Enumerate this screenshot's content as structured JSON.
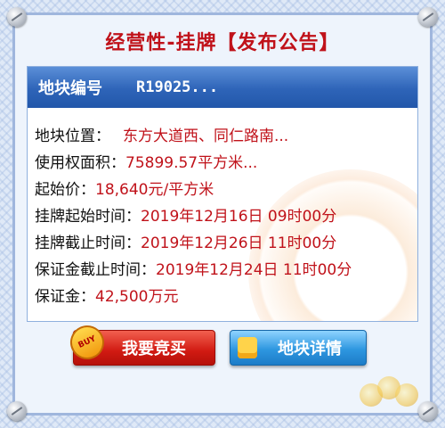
{
  "title": "经营性-挂牌【发布公告】",
  "panel": {
    "header_label": "地块编号",
    "header_value": "R19025..."
  },
  "rows": [
    {
      "label": "地块位置：",
      "value": "东方大道西、同仁路南..."
    },
    {
      "label": "使用权面积：",
      "value": "75899.57平方米..."
    },
    {
      "label": "起始价：",
      "value": "18,640元/平方米"
    },
    {
      "label": "挂牌起始时间：",
      "value": "2019年12月16日 09时00分"
    },
    {
      "label": "挂牌截止时间：",
      "value": "2019年12月26日 11时00分"
    },
    {
      "label": "保证金截止时间：",
      "value": "2019年12月24日 11时00分"
    },
    {
      "label": "保证金：",
      "value": "42,500万元"
    }
  ],
  "buttons": {
    "buy_label": "我要竞买",
    "buy_badge": "BUY",
    "detail_label": "地块详情"
  },
  "colors": {
    "accent_red": "#c0121a",
    "header_blue": "#2e64b8",
    "button_red": "#d11a12",
    "button_blue": "#2e97e0"
  },
  "icons": [
    "screw-icon",
    "buy-badge-icon",
    "detail-icon",
    "coins-decoration"
  ]
}
